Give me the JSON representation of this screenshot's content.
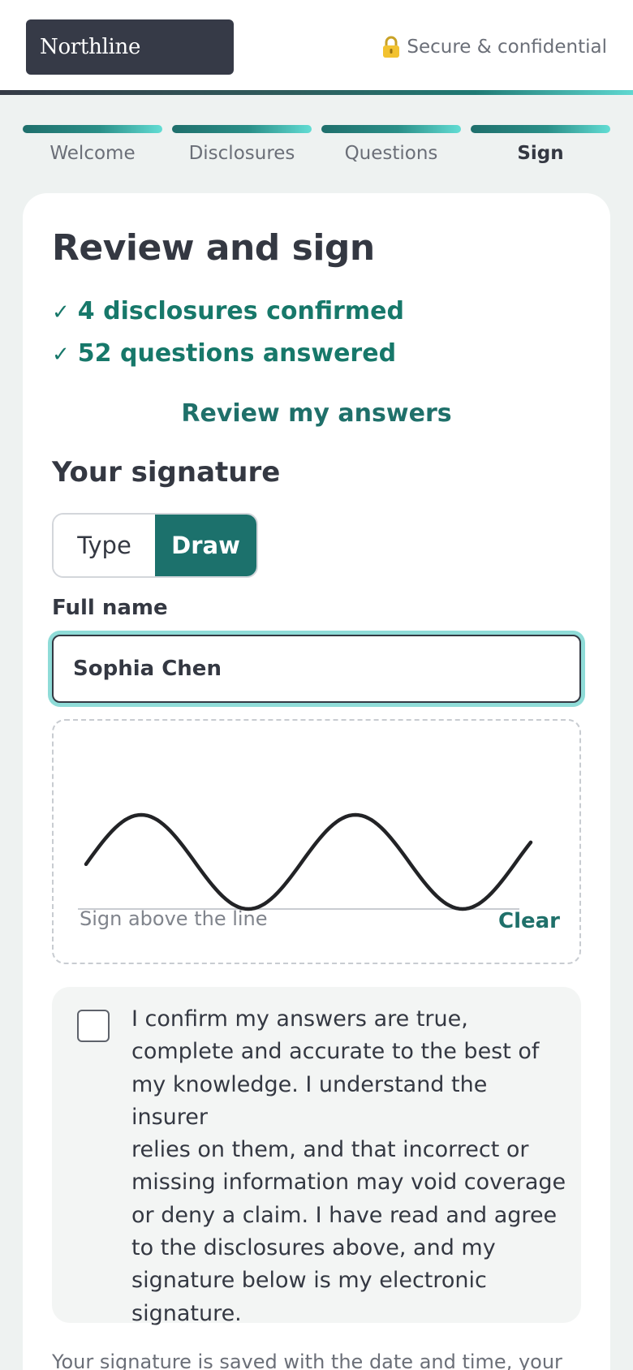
{
  "header": {
    "brand": "Northline",
    "secure_text": "Secure & confidential",
    "lock_icon": "lock-icon"
  },
  "progress": {
    "steps": [
      {
        "label": "Welcome",
        "state": "complete"
      },
      {
        "label": "Disclosures",
        "state": "complete"
      },
      {
        "label": "Questions",
        "state": "complete"
      },
      {
        "label": "Sign",
        "state": "current"
      }
    ]
  },
  "main": {
    "title": "Review and sign",
    "summary": [
      {
        "icon": "✓",
        "text": "4 disclosures confirmed"
      },
      {
        "icon": "✓",
        "text": "52 questions answered"
      }
    ],
    "review_link": "Review my answers",
    "signature": {
      "heading": "Your signature",
      "modes": [
        "Type",
        "Draw"
      ],
      "active_mode": "Draw",
      "full_name_label": "Full name",
      "full_name_value": "Sophia Chen",
      "pad_hint": "Sign above the line",
      "clear_label": "Clear"
    },
    "confirm": {
      "checked": false,
      "lines": [
        "I confirm my answers are true,",
        "complete and accurate to the best of",
        "my knowledge. I understand the insurer",
        "relies on them, and that incorrect or",
        "missing information may void coverage",
        "or deny a claim. I have read and agree",
        "to the disclosures above, and my",
        "signature below is my electronic",
        "signature."
      ]
    },
    "footnote": "Your signature is saved with the date and time, your"
  },
  "colors": {
    "accent": "#1c716c",
    "success_text": "#17786a",
    "brand_bg": "#363a47",
    "focus_ring": "#8fdcd8"
  }
}
